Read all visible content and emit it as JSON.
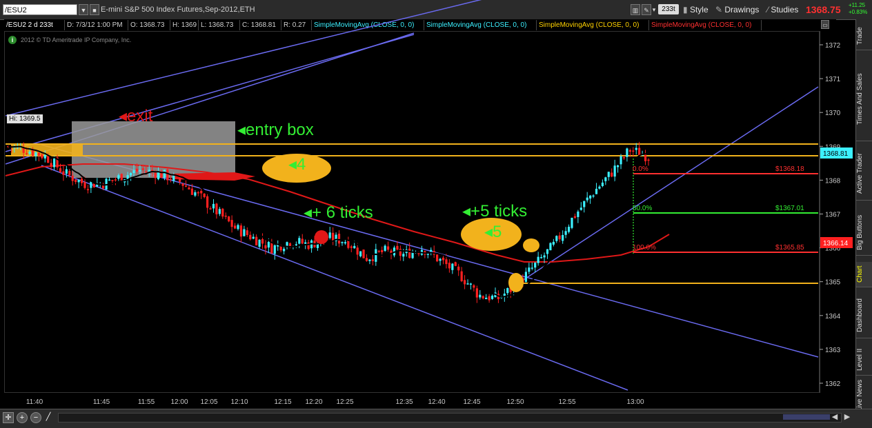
{
  "toolbar": {
    "symbol": "/ESU2",
    "title": "E-mini S&P 500 Index Futures,Sep-2012,ETH",
    "aggregation": "233t",
    "style_label": "Style",
    "drawings_label": "Drawings",
    "studies_label": "Studies",
    "last_price": "1368.75",
    "net_change": "+11.25",
    "pct_change": "+0.83%"
  },
  "infobar": {
    "symbol_agg": "/ESU2 2 d 233t",
    "date": "D: 7/3/12 1:00 PM",
    "open": "O: 1368.73",
    "high": "H: 1369",
    "low": "L: 1368.73",
    "close": "C: 1368.81",
    "range": "R: 0.27",
    "studies": [
      {
        "label": "SimpleMovingAvg (CLOSE, 0, 0)",
        "color": "#3cf0ff"
      },
      {
        "label": "SimpleMovingAvg (CLOSE, 0, 0)",
        "color": "#3cf0ff"
      },
      {
        "label": "SimpleMovingAvg (CLOSE, 0, 0)",
        "color": "#ffd200"
      },
      {
        "label": "SimpleMovingAvg (CLOSE, 0, 0)",
        "color": "#ff3030"
      }
    ]
  },
  "copyright": "2012 © TD Ameritrade IP Company, Inc.",
  "hi_label": "Hi: 1369.5",
  "right_tabs": [
    "Trade",
    "Times And Sales",
    "Active Trader",
    "Big Buttons",
    "Chart",
    "Dashboard",
    "Level II",
    "Live News"
  ],
  "annotations": {
    "exit": "exit",
    "entry_box": "entry box",
    "four": "4",
    "plus6": "+ 6 ticks",
    "plus5": "+5 ticks",
    "five": "5"
  },
  "fib": {
    "levels": [
      {
        "pct": "0.0%",
        "price": "$1368.18",
        "color": "#ff3030"
      },
      {
        "pct": "50.0%",
        "price": "$1367.01",
        "color": "#33ee33"
      },
      {
        "pct": "100.0%",
        "price": "$1365.85",
        "color": "#ff3030"
      }
    ]
  },
  "price_axis": {
    "ticks": [
      "1372",
      "1371",
      "1370",
      "1369",
      "1368",
      "1367",
      "1366",
      "1365",
      "1364",
      "1363",
      "1362"
    ],
    "current_bubble": "1368.81",
    "current_color": "#3cf0ff",
    "red_bubble": "1366.14",
    "red_color": "#ff2020"
  },
  "time_axis": {
    "labels": [
      "11:40",
      "11:45",
      "11:55",
      "12:00",
      "12:05",
      "12:10",
      "12:15",
      "12:20",
      "12:25",
      "12:35",
      "12:40",
      "12:45",
      "12:50",
      "12:55",
      "13:00"
    ]
  },
  "chart_data": {
    "type": "candlestick",
    "symbol": "/ESU2",
    "ylim": [
      1361.8,
      1372.2
    ],
    "yticks": [
      1362,
      1363,
      1364,
      1365,
      1366,
      1367,
      1368,
      1369,
      1370,
      1371,
      1372
    ],
    "xlabels": [
      "11:40",
      "11:45",
      "11:55",
      "12:00",
      "12:05",
      "12:10",
      "12:15",
      "12:20",
      "12:25",
      "12:35",
      "12:40",
      "12:45",
      "12:50",
      "12:55",
      "13:00"
    ],
    "close_path": [
      1369.0,
      1368.9,
      1368.7,
      1368.2,
      1367.9,
      1367.9,
      1368.1,
      1368.3,
      1368.2,
      1368.0,
      1367.6,
      1367.1,
      1366.6,
      1366.3,
      1366.0,
      1366.2,
      1366.1,
      1366.3,
      1366.2,
      1365.7,
      1365.9,
      1365.8,
      1366.0,
      1365.6,
      1365.2,
      1364.6,
      1364.5,
      1364.9,
      1365.5,
      1366.1,
      1366.9,
      1367.6,
      1368.2,
      1368.9,
      1368.7
    ],
    "high": 1369.5,
    "low": 1364.05,
    "last": 1368.81,
    "horizontal_levels": [
      1368.81,
      1369.1,
      1364.95
    ],
    "fib_levels": [
      1368.18,
      1367.01,
      1365.85
    ]
  }
}
